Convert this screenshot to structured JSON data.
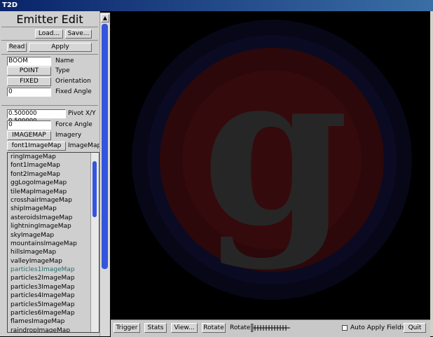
{
  "window": {
    "title": "T2D"
  },
  "panel": {
    "title": "Emitter Edit",
    "load_label": "Load...",
    "save_label": "Save...",
    "read_label": "Read",
    "apply_label": "Apply",
    "name": {
      "value": "BOOM",
      "label": "Name"
    },
    "type": {
      "value": "POINT",
      "label": "Type"
    },
    "orientation": {
      "value": "FIXED",
      "label": "Orientation"
    },
    "fixed_angle": {
      "value": "0",
      "label": "Fixed Angle"
    },
    "pivot": {
      "value": "0.500000 0.500000",
      "label": "Pivot X/Y"
    },
    "force_angle": {
      "value": "0",
      "label": "Force Angle"
    },
    "imagery": {
      "value": "IMAGEMAP",
      "label": "Imagery"
    },
    "imagemap": {
      "value": "font1ImageMap",
      "label": "ImageMap"
    }
  },
  "dropdown": {
    "items": [
      "ringImageMap",
      "font1ImageMap",
      "font2ImageMap",
      "ggLogoImageMap",
      "tileMapImageMap",
      "crosshairImageMap",
      "shipImageMap",
      "asteroidsImageMap",
      "lightningImageMap",
      "skyImageMap",
      "mountainsImageMap",
      "hillsImageMap",
      "valleyImageMap",
      "particles1ImageMap",
      "particles2ImageMap",
      "particles3ImageMap",
      "particles4ImageMap",
      "particles5ImageMap",
      "particles6ImageMap",
      "flamesImageMap",
      "raindropImageMap"
    ],
    "hovered_index": 13
  },
  "toolbar": {
    "trigger_label": "Trigger",
    "stats_label": "Stats",
    "view_label": "View...",
    "rotate_label": "Rotate",
    "rotate_field_label": "Rotate:",
    "auto_apply_label": "Auto Apply Fields?",
    "auto_apply_checked": false,
    "quit_label": "Quit"
  },
  "canvas": {
    "logo_letter": "g"
  },
  "colors": {
    "titlebar": "#0a246a",
    "scroll_thumb": "#3355dd",
    "logo_red": "#3a0a0c",
    "logo_blue": "#0c0c2a"
  }
}
